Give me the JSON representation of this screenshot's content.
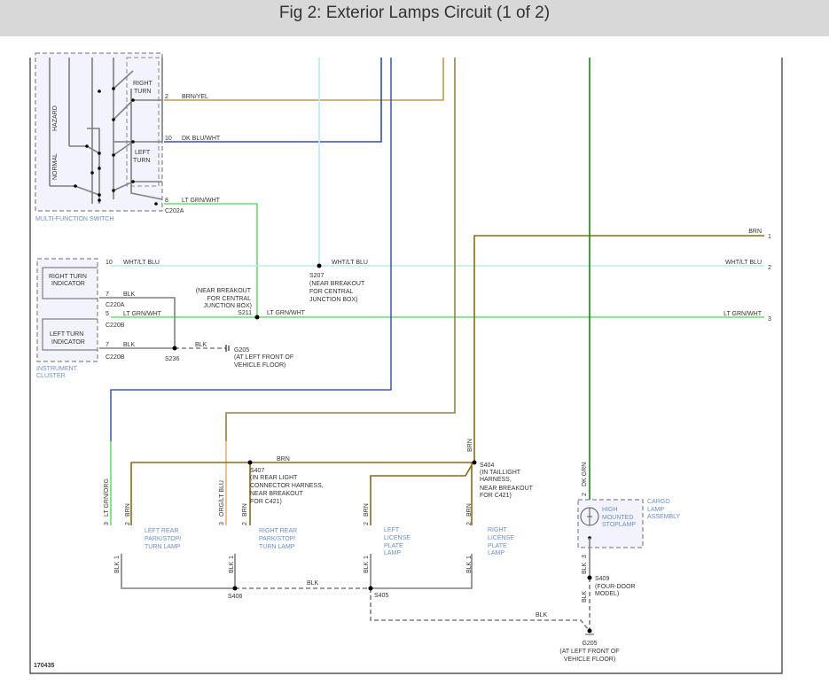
{
  "title": "Fig 2: Exterior Lamps Circuit (1 of 2)",
  "colors": {
    "brn_yel": "#b8a040",
    "dk_blu_wht": "#3050b0",
    "lt_grn_wht": "#66e066",
    "wht_lt_blu": "#b8ecf4",
    "brn": "#8a6a10",
    "dk_grn": "#118811",
    "blu": "#4060c0",
    "org_lt_blu": "#f0b070",
    "blk": "#808080"
  },
  "switch": {
    "label": "MULTI-FUNCTION SWITCH",
    "hazard": "HAZARD",
    "normal": "NORMAL",
    "right_turn": [
      "RIGHT",
      "TURN"
    ],
    "left_turn": [
      "LEFT",
      "TURN"
    ],
    "connector": "C202A",
    "pins": [
      {
        "pin": "2",
        "wire": "BRN/YEL"
      },
      {
        "pin": "10",
        "wire": "DK BLU/WHT"
      },
      {
        "pin": "8",
        "wire": "LT GRN/WHT"
      }
    ]
  },
  "cluster": {
    "label": [
      "INSTRUMENT",
      "CLUSTER"
    ],
    "right_ind": [
      "RIGHT TURN",
      "INDICATOR"
    ],
    "left_ind": [
      "LEFT TURN",
      "INDICATOR"
    ],
    "pins": [
      {
        "pin": "10",
        "wire": "WHT/LT BLU"
      },
      {
        "pin": "7",
        "wire": "BLK",
        "conn": "C220A"
      },
      {
        "pin": "5",
        "wire": "LT GRN/WHT",
        "conn": "C220B"
      },
      {
        "pin": "7",
        "wire": "BLK",
        "conn": "C220B"
      }
    ]
  },
  "splices": {
    "s207": {
      "id": "S207",
      "note": [
        "(NEAR BREAKOUT",
        "FOR CENTRAL",
        "JUNCTION BOX)"
      ],
      "wire": "WHT/LT BLU"
    },
    "s211": {
      "id": "S211",
      "note": [
        "(NEAR BREAKOUT",
        "FOR CENTRAL",
        "JUNCTION BOX)"
      ],
      "wire": "LT GRN/WHT"
    },
    "s236": {
      "id": "S236",
      "wire": "BLK"
    },
    "g205a": {
      "id": "G205",
      "note": [
        "(AT LEFT FRONT OF",
        "VEHICLE FLOOR)"
      ]
    },
    "s407": {
      "id": "S407",
      "note": [
        "(IN REAR LIGHT",
        "CONNECTOR HARNESS,",
        "NEAR BREAKOUT",
        "FOR C421)"
      ],
      "wire": "BRN"
    },
    "s404": {
      "id": "S404",
      "note": [
        "(IN TAILLIGHT",
        "HARNESS,",
        "NEAR BREAKOUT",
        "FOR C421)"
      ],
      "wire": "BRN"
    },
    "s406": {
      "id": "S406",
      "wire": "BLK"
    },
    "s405": {
      "id": "S405",
      "wire": "BLK"
    },
    "s409": {
      "id": "S409",
      "note": [
        "(FOUR-DOOR",
        "MODEL)"
      ]
    },
    "g205b": {
      "id": "G205",
      "note": [
        "(AT LEFT FRONT OF",
        "VEHICLE FLOOR)"
      ],
      "wire": "BLK"
    }
  },
  "offpage": [
    {
      "wire": "BRN",
      "num": "1"
    },
    {
      "wire": "WHT/LT BLU",
      "num": "2"
    },
    {
      "wire": "LT GRN/WHT",
      "num": "3"
    }
  ],
  "lamps": [
    {
      "name": [
        "LEFT REAR",
        "PARK/STOP/",
        "TURN LAMP"
      ],
      "top": [
        {
          "pin": "3",
          "wire": "LT GRN/ORG"
        },
        {
          "pin": "2",
          "wire": "BRN"
        }
      ],
      "bottom": {
        "pin": "1",
        "wire": "BLK"
      }
    },
    {
      "name": [
        "RIGHT REAR",
        "PARK/STOP/",
        "TURN LAMP"
      ],
      "top": [
        {
          "pin": "3",
          "wire": "ORG/LT BLU"
        },
        {
          "pin": "2",
          "wire": "BRN"
        }
      ],
      "bottom": {
        "pin": "1",
        "wire": "BLK"
      }
    },
    {
      "name": [
        "LEFT",
        "LICENSE",
        "PLATE",
        "LAMP"
      ],
      "top": [
        {
          "pin": "2",
          "wire": "BRN"
        }
      ],
      "bottom": {
        "pin": "1",
        "wire": "BLK"
      }
    },
    {
      "name": [
        "RIGHT",
        "LICENSE",
        "PLATE",
        "LAMP"
      ],
      "top": [
        {
          "pin": "2",
          "wire": "BRN"
        }
      ],
      "bottom": {
        "pin": "1",
        "wire": "BLK"
      }
    }
  ],
  "cargo": {
    "assembly": [
      "CARGO",
      "LAMP",
      "ASSEMBLY"
    ],
    "lamp": [
      "HIGH",
      "MOUNTED",
      "STOPLAMP"
    ],
    "top": {
      "pin": "2",
      "wire": "DK GRN"
    },
    "bottom": {
      "pin": "3",
      "wire": "BLK"
    },
    "lower_wire": "BLK"
  },
  "figure_id": "170435"
}
